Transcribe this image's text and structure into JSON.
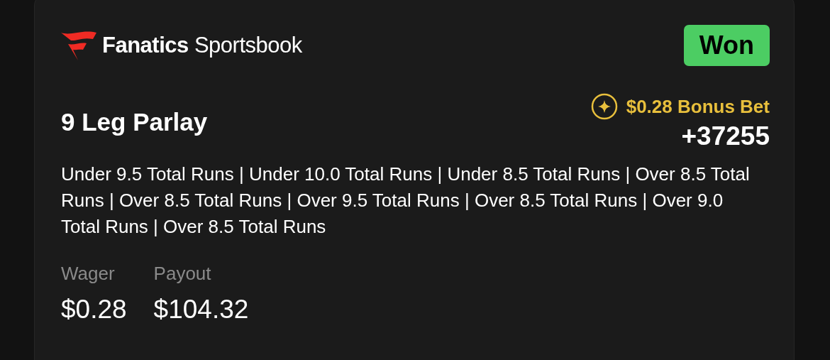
{
  "brand": {
    "name_bold": "Fanatics",
    "name_light": "Sportsbook"
  },
  "status": {
    "label": "Won",
    "kind": "won"
  },
  "bet": {
    "title": "9 Leg Parlay",
    "bonus": "$0.28 Bonus Bet",
    "odds": "+37255",
    "legs": "Under 9.5 Total Runs | Under 10.0 Total Runs | Under 8.5 Total Runs | Over 8.5 Total Runs | Over 8.5 Total Runs | Over 9.5 Total Runs | Over 8.5 Total Runs | Over 9.0 Total Runs | Over 8.5 Total Runs"
  },
  "amounts": [
    {
      "label": "Wager",
      "value": "$0.28"
    },
    {
      "label": "Payout",
      "value": "$104.32"
    }
  ]
}
